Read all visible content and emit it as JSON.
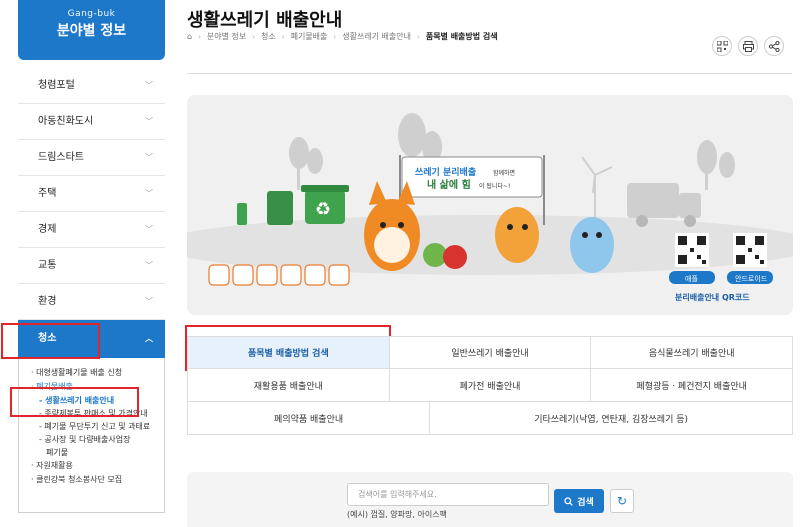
{
  "brand": {
    "en": "Gang-buk",
    "ko": "분야별 정보"
  },
  "sidebar": {
    "items": [
      {
        "label": "청렴포털"
      },
      {
        "label": "아동친화도시"
      },
      {
        "label": "드림스타트"
      },
      {
        "label": "주택"
      },
      {
        "label": "경제"
      },
      {
        "label": "교통"
      },
      {
        "label": "환경"
      },
      {
        "label": "청소"
      }
    ],
    "submenu": {
      "l1_a": "· 대형생활폐기물 배출 신청",
      "l1_b": "· 폐기물배출",
      "l2_a": "- 생활쓰레기 배출안내",
      "l2_b": "- 종량제봉투 판매소 및 가격안내",
      "l2_c": "- 폐기물 무단투기 신고 및 과태료",
      "l2_d": "- 공사장 및 다량배출사업장",
      "l2_d2": "폐기물",
      "l1_c": "· 자원재활용",
      "l1_d": "· 클린강북 청소봉사단 모집"
    }
  },
  "header": {
    "title": "생활쓰레기 배출안내",
    "breadcrumb": [
      "분야별 정보",
      "청소",
      "폐기물배출",
      "생활쓰레기 배출안내",
      "품목별 배출방법 검색"
    ]
  },
  "banner": {
    "sign_line1": "쓰레기 분리배출",
    "sign_line1b": "함께하면",
    "sign_line2": "내 삶에 힘",
    "sign_line2b": "이 됩니다~!",
    "qr_android_label": "애플",
    "qr_ios_label": "안드로이드",
    "qr_caption": "분리배출안내 QR코드"
  },
  "tabs": {
    "row1": [
      "품목별 배출방법 검색",
      "일반쓰레기 배출안내",
      "음식물쓰레기 배출안내"
    ],
    "row2": [
      "재활용품 배출안내",
      "폐가전 배출안내",
      "폐형광등ㆍ폐건전지 배출안내"
    ],
    "row3": [
      "폐의약품 배출안내",
      "기타쓰레기(낙엽, 연탄재, 김장쓰레기 등)"
    ]
  },
  "search": {
    "placeholder": "검색어를 입력해주세요.",
    "example": "(예시) 껍질, 양파망, 아이스팩",
    "button": "검색"
  },
  "colors": {
    "accent": "#1d78c9",
    "highlight": "#e0252b"
  }
}
